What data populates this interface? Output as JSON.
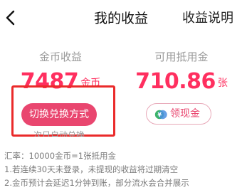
{
  "header": {
    "title": "我的收益",
    "help_label": "收益说明",
    "back_icon": "chevron-left-icon"
  },
  "coin": {
    "label": "金币收益",
    "value": "7487",
    "unit": "金币",
    "button_label": "切换兑换方式",
    "note": "次日自动兑换"
  },
  "voucher": {
    "label": "可用抵用金",
    "value": "710.86",
    "unit": "张",
    "button_label": "领现金",
    "button_icon": "cash-voucher-icon"
  },
  "rules": [
    "汇率：10000金币=1张抵用金",
    "1.若连续30天未登录，未提现的收益将过期清空",
    "2.金币预计会延迟1分钟到账，部分流水会合并展示"
  ],
  "colors": {
    "accent": "#ff2f5f",
    "button_bg": "#e9466f",
    "highlight": "#ea2a2a",
    "muted_text": "#9a9a9a"
  }
}
